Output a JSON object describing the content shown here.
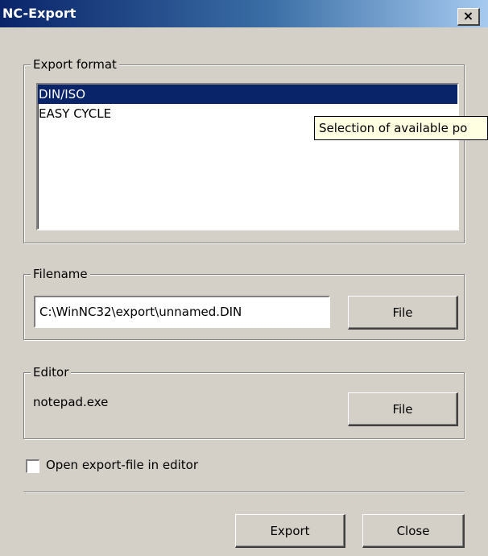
{
  "window": {
    "title": "NC-Export",
    "close_glyph": "×"
  },
  "export_format": {
    "legend": "Export format",
    "items": [
      "DIN/ISO",
      "EASY CYCLE"
    ],
    "selected_index": 0,
    "tooltip": "Selection of available po"
  },
  "filename": {
    "legend": "Filename",
    "value": "C:\\WinNC32\\export\\unnamed.DIN",
    "button_label": "File"
  },
  "editor": {
    "legend": "Editor",
    "value": "notepad.exe",
    "button_label": "File"
  },
  "open_in_editor": {
    "label": "Open export-file in editor",
    "checked": false
  },
  "actions": {
    "export_label": "Export",
    "close_label": "Close"
  },
  "colors": {
    "title_bar": "#0a246a",
    "selection": "#0a246a",
    "face": "#d4d0c8",
    "tooltip_bg": "#ffffe1"
  }
}
